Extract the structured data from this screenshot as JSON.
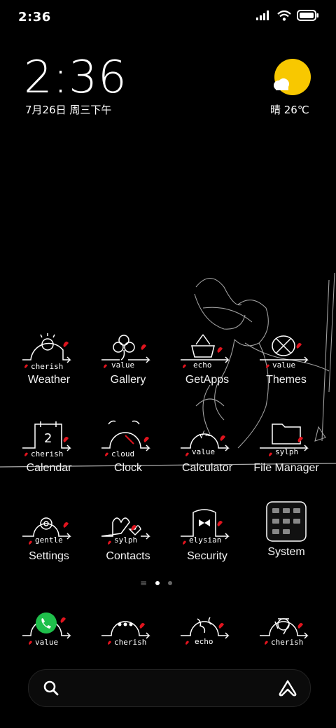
{
  "status_bar": {
    "time": "2:36"
  },
  "clock_widget": {
    "time": "2:36",
    "date": "7月26日 周三下午",
    "weather": "晴 26℃"
  },
  "apps": [
    {
      "label": "Weather",
      "tag": "cherish"
    },
    {
      "label": "Gallery",
      "tag": "value"
    },
    {
      "label": "GetApps",
      "tag": "echo"
    },
    {
      "label": "Themes",
      "tag": "value"
    },
    {
      "label": "Calendar",
      "tag": "cherish",
      "badge": "2"
    },
    {
      "label": "Clock",
      "tag": "cloud"
    },
    {
      "label": "Calculator",
      "tag": "value"
    },
    {
      "label": "File Manager",
      "tag": "sylph"
    },
    {
      "label": "Settings",
      "tag": "gentle"
    },
    {
      "label": "Contacts",
      "tag": "sylph"
    },
    {
      "label": "Security",
      "tag": "elysian"
    },
    {
      "label": "System",
      "tag": ""
    }
  ],
  "dock": [
    {
      "tag": "value"
    },
    {
      "tag": "cherish"
    },
    {
      "tag": "echo"
    },
    {
      "tag": "cherish"
    }
  ],
  "colors": {
    "sun": "#f8c800",
    "heart": "#e0141e",
    "phone_green": "#1fbf4b"
  }
}
